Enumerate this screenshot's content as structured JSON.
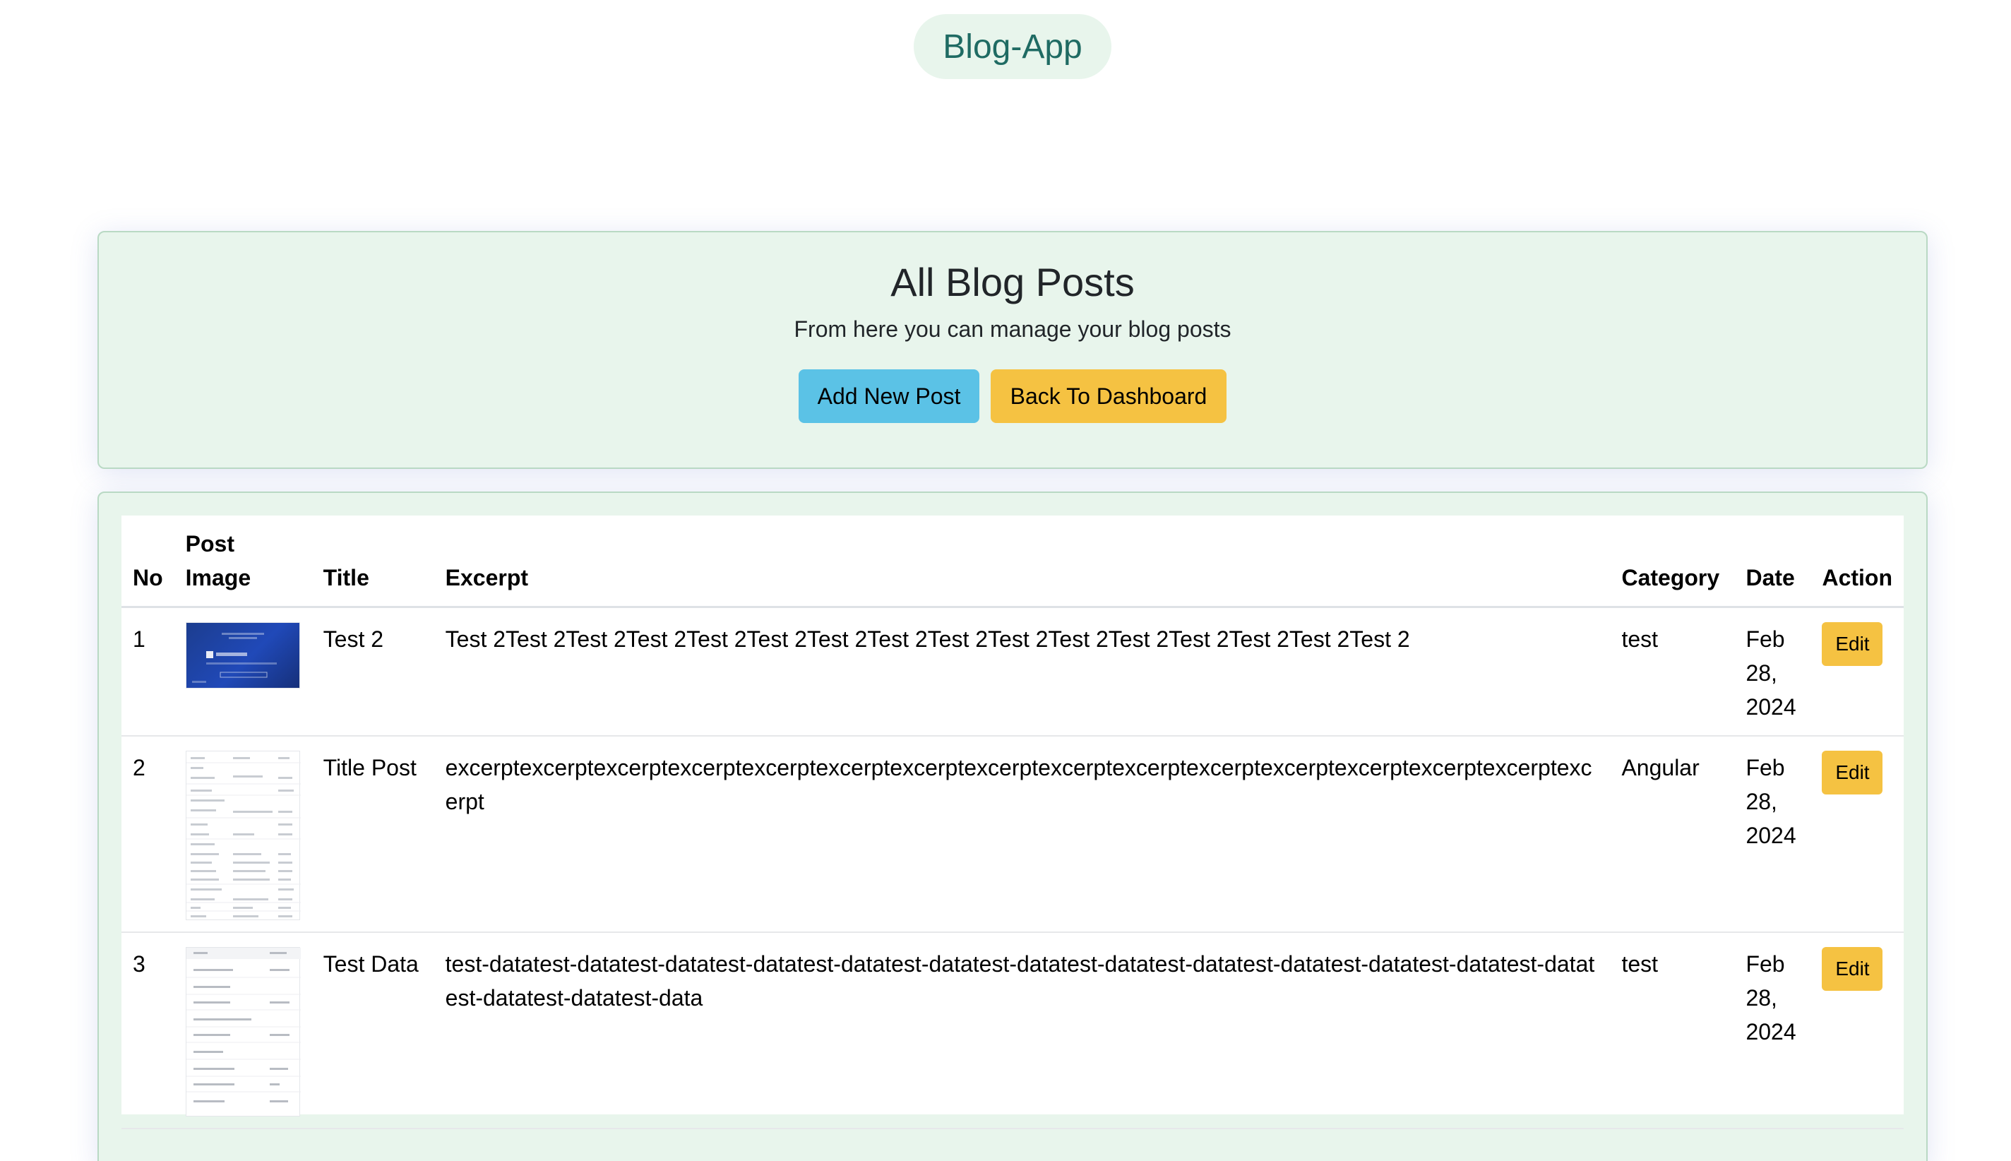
{
  "app": {
    "brand": "Blog-App"
  },
  "header": {
    "title": "All Blog Posts",
    "subtitle": "From here you can manage your blog posts",
    "add_button": "Add New Post",
    "back_button": "Back To Dashboard"
  },
  "table": {
    "columns": {
      "no": "No",
      "image_line1": "Post",
      "image_line2": "Image",
      "title": "Title",
      "excerpt": "Excerpt",
      "category": "Category",
      "date": "Date",
      "action": "Action"
    },
    "rows": [
      {
        "no": "1",
        "title": "Test 2",
        "excerpt": "Test 2Test 2Test 2Test 2Test 2Test 2Test 2Test 2Test 2Test 2Test 2Test 2Test 2Test 2Test 2Test 2",
        "category": "test",
        "date_month": "Feb",
        "date_day": "28,",
        "date_year": "2024",
        "action": "Edit"
      },
      {
        "no": "2",
        "title": "Title Post",
        "excerpt": "excerptexcerptexcerptexcerptexcerptexcerptexcerptexcerptexcerptexcerptexcerptexcerptexcerptexcerptexcerptexcerpt",
        "category": "Angular",
        "date_month": "Feb",
        "date_day": "28,",
        "date_year": "2024",
        "action": "Edit"
      },
      {
        "no": "3",
        "title": "Test Data",
        "excerpt": "test-datatest-datatest-datatest-datatest-datatest-datatest-datatest-datatest-datatest-datatest-datatest-datatest-datatest-datatest-datatest-data",
        "category": "test",
        "date_month": "Feb",
        "date_day": "28,",
        "date_year": "2024",
        "action": "Edit"
      }
    ]
  },
  "colors": {
    "card_bg": "#e8f5ec",
    "info": "#5bc2e6",
    "warning": "#f5c242",
    "brand_text": "#1f6b63"
  }
}
